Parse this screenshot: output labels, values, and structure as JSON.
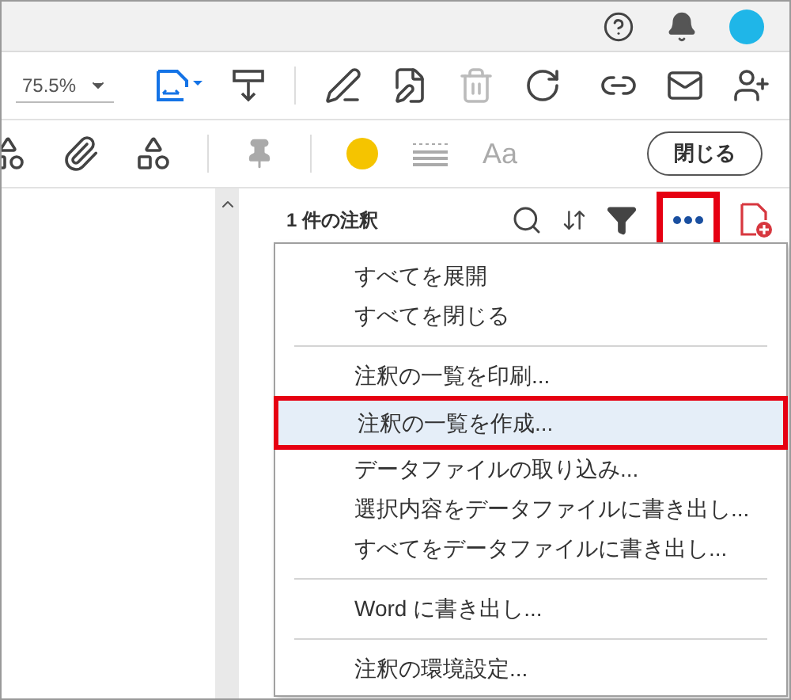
{
  "toolbar": {
    "zoom": "75.5%"
  },
  "annotation_toolbar": {
    "color": "#f5c400",
    "font_label": "Aa",
    "close_button": "閉じる"
  },
  "comments_panel": {
    "title": "1 件の注釈",
    "more_button": {
      "highlighted": true
    }
  },
  "menu": {
    "groups": [
      [
        {
          "label": "すべてを展開",
          "highlighted": false
        },
        {
          "label": "すべてを閉じる",
          "highlighted": false
        }
      ],
      [
        {
          "label": "注釈の一覧を印刷...",
          "highlighted": false
        },
        {
          "label": "注釈の一覧を作成...",
          "highlighted": true
        },
        {
          "label": "データファイルの取り込み...",
          "highlighted": false
        },
        {
          "label": "選択内容をデータファイルに書き出し...",
          "highlighted": false
        },
        {
          "label": "すべてをデータファイルに書き出し...",
          "highlighted": false
        }
      ],
      [
        {
          "label": "Word に書き出し...",
          "highlighted": false
        }
      ],
      [
        {
          "label": "注釈の環境設定...",
          "highlighted": false
        }
      ]
    ]
  }
}
